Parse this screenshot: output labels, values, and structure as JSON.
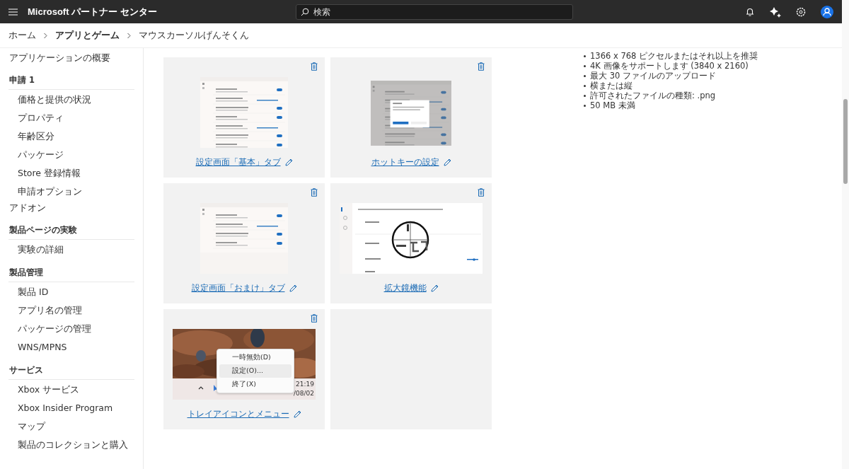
{
  "header": {
    "title": "Microsoft パートナー センター",
    "search": {
      "placeholder": "検索"
    }
  },
  "breadcrumb": [
    {
      "label": "ホーム",
      "current": false
    },
    {
      "label": "アプリとゲーム",
      "current": true
    },
    {
      "label": "マウスカーソルげんそくん",
      "current": false
    }
  ],
  "sidebar": [
    {
      "kind": "top",
      "label": "アプリケーションの概要"
    },
    {
      "kind": "header",
      "label": "申請 1"
    },
    {
      "kind": "item",
      "label": "価格と提供の状況"
    },
    {
      "kind": "item",
      "label": "プロパティ"
    },
    {
      "kind": "item",
      "label": "年齢区分"
    },
    {
      "kind": "item",
      "label": "パッケージ"
    },
    {
      "kind": "item",
      "label": "Store 登録情報"
    },
    {
      "kind": "item",
      "label": "申請オプション"
    },
    {
      "kind": "top",
      "label": "アドオン"
    },
    {
      "kind": "header",
      "label": "製品ページの実験"
    },
    {
      "kind": "item",
      "label": "実験の詳細"
    },
    {
      "kind": "header",
      "label": "製品管理"
    },
    {
      "kind": "item",
      "label": "製品 ID"
    },
    {
      "kind": "item",
      "label": "アプリ名の管理"
    },
    {
      "kind": "item",
      "label": "パッケージの管理"
    },
    {
      "kind": "item",
      "label": "WNS/MPNS"
    },
    {
      "kind": "header",
      "label": "サービス"
    },
    {
      "kind": "item",
      "label": "Xbox サービス"
    },
    {
      "kind": "item",
      "label": "Xbox Insider Program"
    },
    {
      "kind": "item",
      "label": "マップ"
    },
    {
      "kind": "item",
      "label": "製品のコレクションと購入"
    }
  ],
  "screenshots": [
    {
      "kind": "settings",
      "caption": "設定画面「基本」タブ"
    },
    {
      "kind": "dialog",
      "caption": "ホットキーの設定"
    },
    {
      "kind": "settings-short",
      "caption": "設定画面「おまけ」タブ"
    },
    {
      "kind": "magnifier",
      "caption": "拡大鏡機能"
    },
    {
      "kind": "tray",
      "caption": "トレイアイコンとメニュー",
      "menu": [
        {
          "label": "一時無効(D)",
          "selected": false
        },
        {
          "label": "設定(O)...",
          "selected": true
        },
        {
          "label": "終了(X)",
          "selected": false
        }
      ],
      "time": "21:19",
      "date": "/08/02"
    },
    {
      "kind": "blank"
    }
  ],
  "requirements": [
    "1366 x 768 ピクセルまたはそれ以上を推奨",
    "4K 画像をサポートします (3840 x 2160)",
    "最大 30 ファイルのアップロード",
    "横または縦",
    "許可されたファイルの種類: .png",
    "50 MB 未満"
  ]
}
